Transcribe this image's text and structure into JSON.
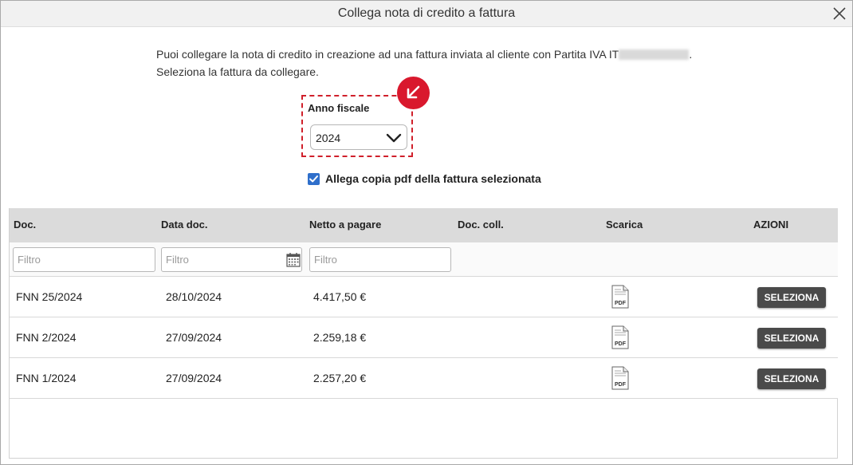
{
  "dialog": {
    "title": "Collega nota di credito a fattura",
    "intro_line1": "Puoi collegare la nota di credito in creazione ad una fattura inviata al cliente con Partita IVA IT",
    "intro_line1_end": ".",
    "intro_line2": "Seleziona la fattura da collegare."
  },
  "year": {
    "label": "Anno fiscale",
    "selected": "2024"
  },
  "attach": {
    "label": "Allega copia pdf della fattura selezionata",
    "checked": true
  },
  "table": {
    "headers": {
      "doc": "Doc.",
      "date": "Data doc.",
      "net": "Netto a pagare",
      "linked": "Doc. coll.",
      "download": "Scarica",
      "actions": "AZIONI"
    },
    "filters": {
      "doc_placeholder": "Filtro",
      "date_placeholder": "Filtro",
      "net_placeholder": "Filtro"
    },
    "rows": [
      {
        "doc": "FNN 25/2024",
        "date": "28/10/2024",
        "net": "4.417,50 €",
        "pdf_label": "PDF",
        "action": "SELEZIONA"
      },
      {
        "doc": "FNN 2/2024",
        "date": "27/09/2024",
        "net": "2.259,18 €",
        "pdf_label": "PDF",
        "action": "SELEZIONA"
      },
      {
        "doc": "FNN 1/2024",
        "date": "27/09/2024",
        "net": "2.257,20 €",
        "pdf_label": "PDF",
        "action": "SELEZIONA"
      }
    ]
  },
  "colors": {
    "accent_red": "#d9182d",
    "checkbox_blue": "#2f6fcb",
    "button_dark": "#4a4a4a"
  },
  "icons": {
    "close": "close-icon",
    "chevron": "chevron-down-icon",
    "arrow": "arrow-down-left-icon",
    "calendar": "calendar-icon",
    "pdf": "pdf-file-icon",
    "check": "check-icon"
  }
}
